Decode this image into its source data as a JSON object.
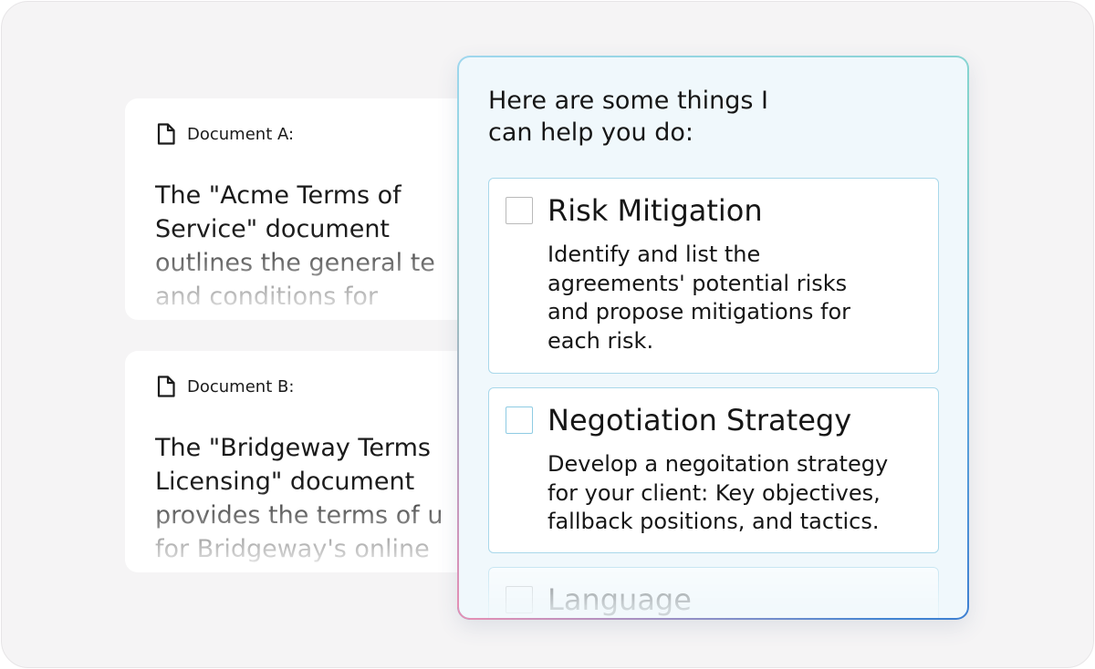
{
  "documents": [
    {
      "label": "Document A:",
      "lines": [
        "The \"Acme Terms of",
        "Service\" document",
        "outlines the general te",
        "and conditions for"
      ]
    },
    {
      "label": "Document B:",
      "lines": [
        "The \"Bridgeway Terms",
        "Licensing\" document",
        "provides the terms of u",
        "for Bridgeway's online"
      ]
    }
  ],
  "assistant": {
    "title_lines": [
      "Here are some things I",
      "can help you do:"
    ],
    "options": [
      {
        "title": "Risk Mitigation",
        "desc_lines": [
          "Identify and list the",
          "agreements' potential risks",
          "and propose mitigations for",
          "each risk."
        ]
      },
      {
        "title": "Negotiation Strategy",
        "desc_lines": [
          "Develop a negoitation strategy",
          "for your client: Key objectives,",
          "fallback positions, and tactics."
        ]
      },
      {
        "title": "Language"
      }
    ]
  },
  "colors": {
    "page_bg": "#f5f4f5",
    "panel_bg": "#f0f8fc",
    "option_border": "#a9d8ea",
    "accent_blue": "#3d7fd1",
    "accent_pink": "#e88fb3"
  },
  "icons": {
    "document": "file-icon"
  }
}
